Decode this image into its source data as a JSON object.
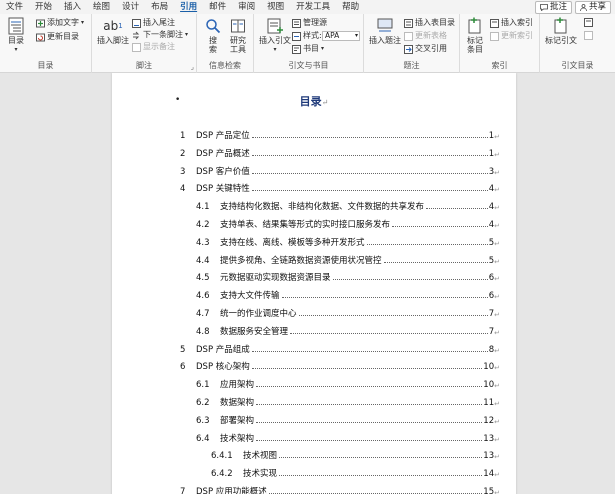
{
  "menu": {
    "tabs": [
      "文件",
      "开始",
      "插入",
      "绘图",
      "设计",
      "布局",
      "引用",
      "邮件",
      "审阅",
      "视图",
      "开发工具",
      "帮助"
    ],
    "active_tab": "引用",
    "comment_label": "批注",
    "share_label": "共享"
  },
  "ribbon": {
    "toc_group": {
      "label": "目录",
      "toc_btn": "目录",
      "add_text": "添加文字",
      "update_toc": "更新目录"
    },
    "footnote_group": {
      "label": "脚注",
      "insert_footnote": "插入脚注",
      "insert_endnote": "插入尾注",
      "next_footnote": "下一条脚注",
      "show_notes": "显示备注",
      "ab_glyph": "ab",
      "sup_glyph": "1"
    },
    "research_group": {
      "label": "信息检索",
      "search": "搜索",
      "researcher": "研究工具"
    },
    "citation_group": {
      "label": "引文与书目",
      "insert_citation": "插入引文",
      "manage_sources": "管理源",
      "style_label": "样式:",
      "style_value": "APA",
      "bibliography": "书目"
    },
    "caption_group": {
      "label": "题注",
      "insert_caption": "插入题注",
      "insert_table_of_figures": "插入表目录",
      "update_table": "更新表格",
      "cross_reference": "交叉引用"
    },
    "index_group": {
      "label": "索引",
      "mark_entry": "标记条目",
      "insert_index": "插入索引",
      "update_index": "更新索引"
    },
    "authorities_group": {
      "label": "引文目录",
      "mark_citation": "标记引文"
    }
  },
  "document": {
    "title": "目录",
    "para_mark": "↵",
    "bullet": "•",
    "toc": [
      {
        "num": "1",
        "text": "DSP 产品定位",
        "page": "1",
        "level": 1
      },
      {
        "num": "2",
        "text": "DSP 产品概述",
        "page": "1",
        "level": 1
      },
      {
        "num": "3",
        "text": "DSP 客户价值",
        "page": "3",
        "level": 1
      },
      {
        "num": "4",
        "text": "DSP 关键特性",
        "page": "4",
        "level": 1
      },
      {
        "num": "4.1",
        "text": "支持结构化数据、非结构化数据、文件数据的共享发布",
        "page": "4",
        "level": 2
      },
      {
        "num": "4.2",
        "text": "支持单表、结果集等形式的实时接口服务发布",
        "page": "4",
        "level": 2
      },
      {
        "num": "4.3",
        "text": "支持在线、离线、模板等多种开发形式",
        "page": "5",
        "level": 2
      },
      {
        "num": "4.4",
        "text": "提供多视角、全链路数据资源使用状况管控",
        "page": "5",
        "level": 2
      },
      {
        "num": "4.5",
        "text": "元数据驱动实现数据资源目录",
        "page": "6",
        "level": 2
      },
      {
        "num": "4.6",
        "text": "支持大文件传输",
        "page": "6",
        "level": 2
      },
      {
        "num": "4.7",
        "text": "统一的作业调度中心",
        "page": "7",
        "level": 2
      },
      {
        "num": "4.8",
        "text": "数据服务安全管理",
        "page": "7",
        "level": 2
      },
      {
        "num": "5",
        "text": "DSP 产品组成",
        "page": "8",
        "level": 1
      },
      {
        "num": "6",
        "text": "DSP 核心架构",
        "page": "10",
        "level": 1
      },
      {
        "num": "6.1",
        "text": "应用架构",
        "page": "10",
        "level": 2
      },
      {
        "num": "6.2",
        "text": "数据架构",
        "page": "11",
        "level": 2
      },
      {
        "num": "6.3",
        "text": "部署架构",
        "page": "12",
        "level": 2
      },
      {
        "num": "6.4",
        "text": "技术架构",
        "page": "13",
        "level": 2
      },
      {
        "num": "6.4.1",
        "text": "技术视图",
        "page": "13",
        "level": 3
      },
      {
        "num": "6.4.2",
        "text": "技术实现",
        "page": "14",
        "level": 3
      },
      {
        "num": "7",
        "text": "DSP 应用功能概述",
        "page": "15",
        "level": 1
      }
    ]
  },
  "colors": {
    "accent": "#1a5fa8",
    "title": "#1f3a7a",
    "ribbon_bg": "#f8f8f8",
    "canvas": "#e6e6e6"
  }
}
